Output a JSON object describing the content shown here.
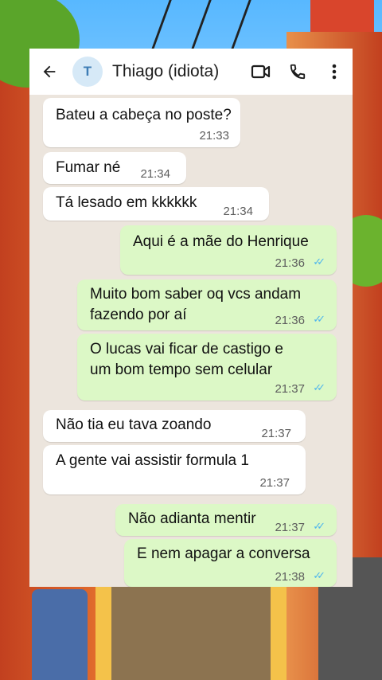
{
  "chat": {
    "contact_name": "Thiago (idiota)",
    "avatar_initial": "T",
    "icons": {
      "back": "arrow-left-icon",
      "video": "video-camera-icon",
      "call": "phone-icon",
      "menu": "more-vertical-icon"
    }
  },
  "messages": [
    {
      "dir": "in",
      "text": "Bateu a cabeça no poste?",
      "time": "21:33"
    },
    {
      "dir": "in",
      "text": "Fumar né",
      "time": "21:34"
    },
    {
      "dir": "in",
      "text": "Tá lesado em kkkkkk",
      "time": "21:34"
    },
    {
      "dir": "out",
      "text": "Aqui é a mãe do Henrique",
      "time": "21:36",
      "status": "read"
    },
    {
      "dir": "out",
      "line1": "Muito bom saber oq vcs andam",
      "line2": "fazendo por aí",
      "time": "21:36",
      "status": "read"
    },
    {
      "dir": "out",
      "line1": "O lucas vai ficar de castigo e",
      "line2": "um bom tempo sem celular",
      "time": "21:37",
      "status": "read"
    },
    {
      "dir": "in",
      "text": "Não tia eu tava zoando",
      "time": "21:37"
    },
    {
      "dir": "in",
      "text": "A gente vai assistir formula 1",
      "time": "21:37"
    },
    {
      "dir": "out",
      "text": "Não adianta mentir",
      "time": "21:37",
      "status": "read"
    },
    {
      "dir": "out",
      "text": "E nem apagar a conversa",
      "time": "21:38",
      "status": "read"
    }
  ],
  "colors": {
    "incoming_bubble": "#ffffff",
    "outgoing_bubble": "#dcf8c6",
    "read_ticks": "#4fb6ec",
    "chat_background": "#ece5dd"
  }
}
